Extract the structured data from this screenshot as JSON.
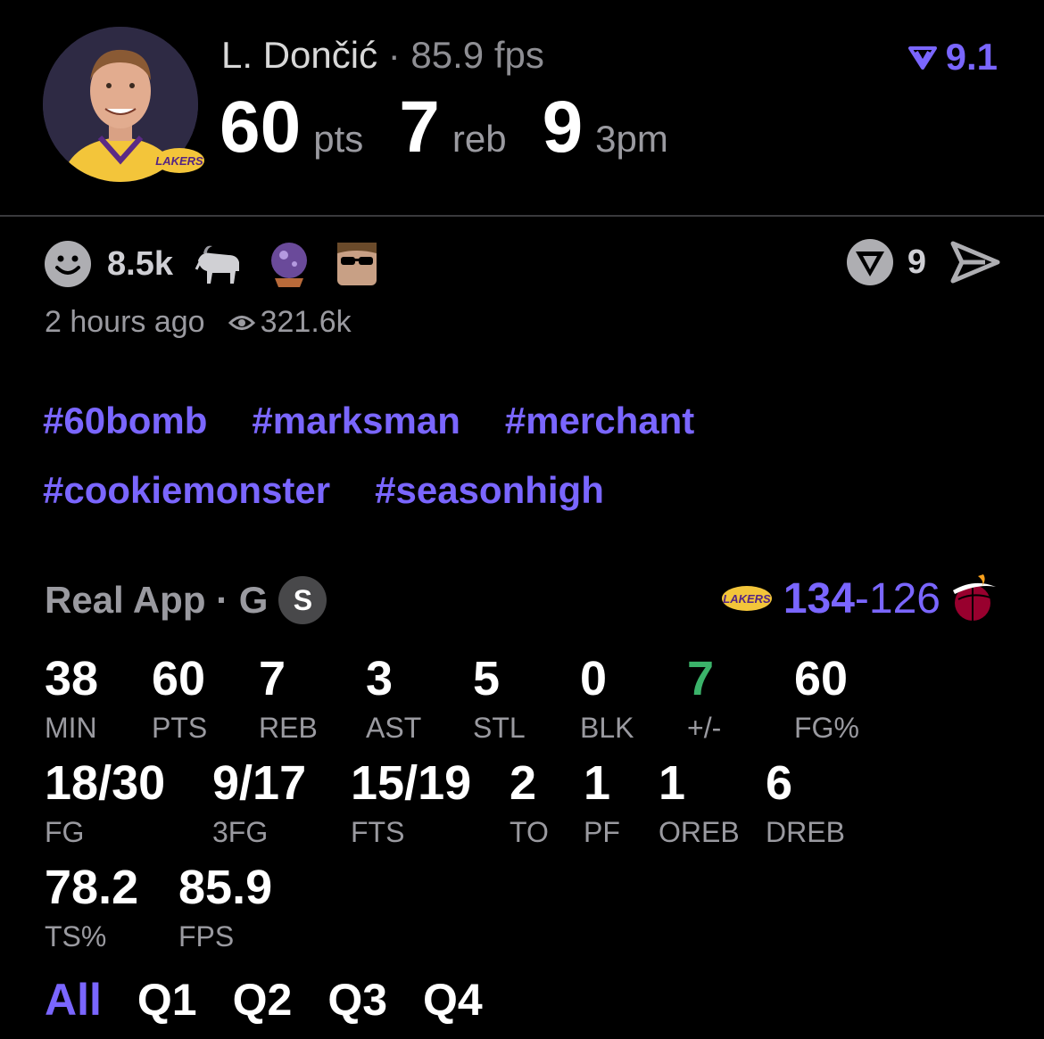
{
  "player": {
    "name": "L. Dončić",
    "separator": "·",
    "fps": "85.9 fps",
    "rating": "9.1",
    "team_badge": "LAKERS"
  },
  "statline": [
    {
      "value": "60",
      "unit": "pts"
    },
    {
      "value": "7",
      "unit": "reb"
    },
    {
      "value": "9",
      "unit": "3pm"
    }
  ],
  "reactions": {
    "smile_count": "8.5k",
    "emojis": [
      "goat-icon",
      "crystal-ball-icon",
      "sunglasses-avatar-icon"
    ],
    "tag_count": "9"
  },
  "meta": {
    "time": "2 hours ago",
    "views": "321.6k"
  },
  "hashtags": {
    "row1": [
      "#60bomb",
      "#marksman",
      "#merchant"
    ],
    "row2": [
      "#cookiemonster",
      "#seasonhigh"
    ]
  },
  "source": {
    "app": "Real App · G",
    "badge": "S"
  },
  "score": {
    "home_logo_text": "LAKERS",
    "home": "134",
    "dash": "-",
    "away": "126"
  },
  "stats": [
    {
      "value": "38",
      "label": "MIN"
    },
    {
      "value": "60",
      "label": "PTS"
    },
    {
      "value": "7",
      "label": "REB"
    },
    {
      "value": "3",
      "label": "AST"
    },
    {
      "value": "5",
      "label": "STL"
    },
    {
      "value": "0",
      "label": "BLK"
    },
    {
      "value": "7",
      "label": "+/-"
    },
    {
      "value": "60",
      "label": "FG%"
    },
    {
      "value": "18/30",
      "label": "FG"
    },
    {
      "value": "9/17",
      "label": "3FG"
    },
    {
      "value": "15/19",
      "label": "FTS"
    },
    {
      "value": "2",
      "label": "TO"
    },
    {
      "value": "1",
      "label": "PF"
    },
    {
      "value": "1",
      "label": "OREB"
    },
    {
      "value": "6",
      "label": "DREB"
    },
    {
      "value": "78.2",
      "label": "TS%"
    },
    {
      "value": "85.9",
      "label": "FPS"
    }
  ],
  "tabs": [
    "All",
    "Q1",
    "Q2",
    "Q3",
    "Q4"
  ],
  "colors": {
    "accent": "#7a66ff",
    "positive": "#3bb36a",
    "muted": "#9a9aa0"
  }
}
